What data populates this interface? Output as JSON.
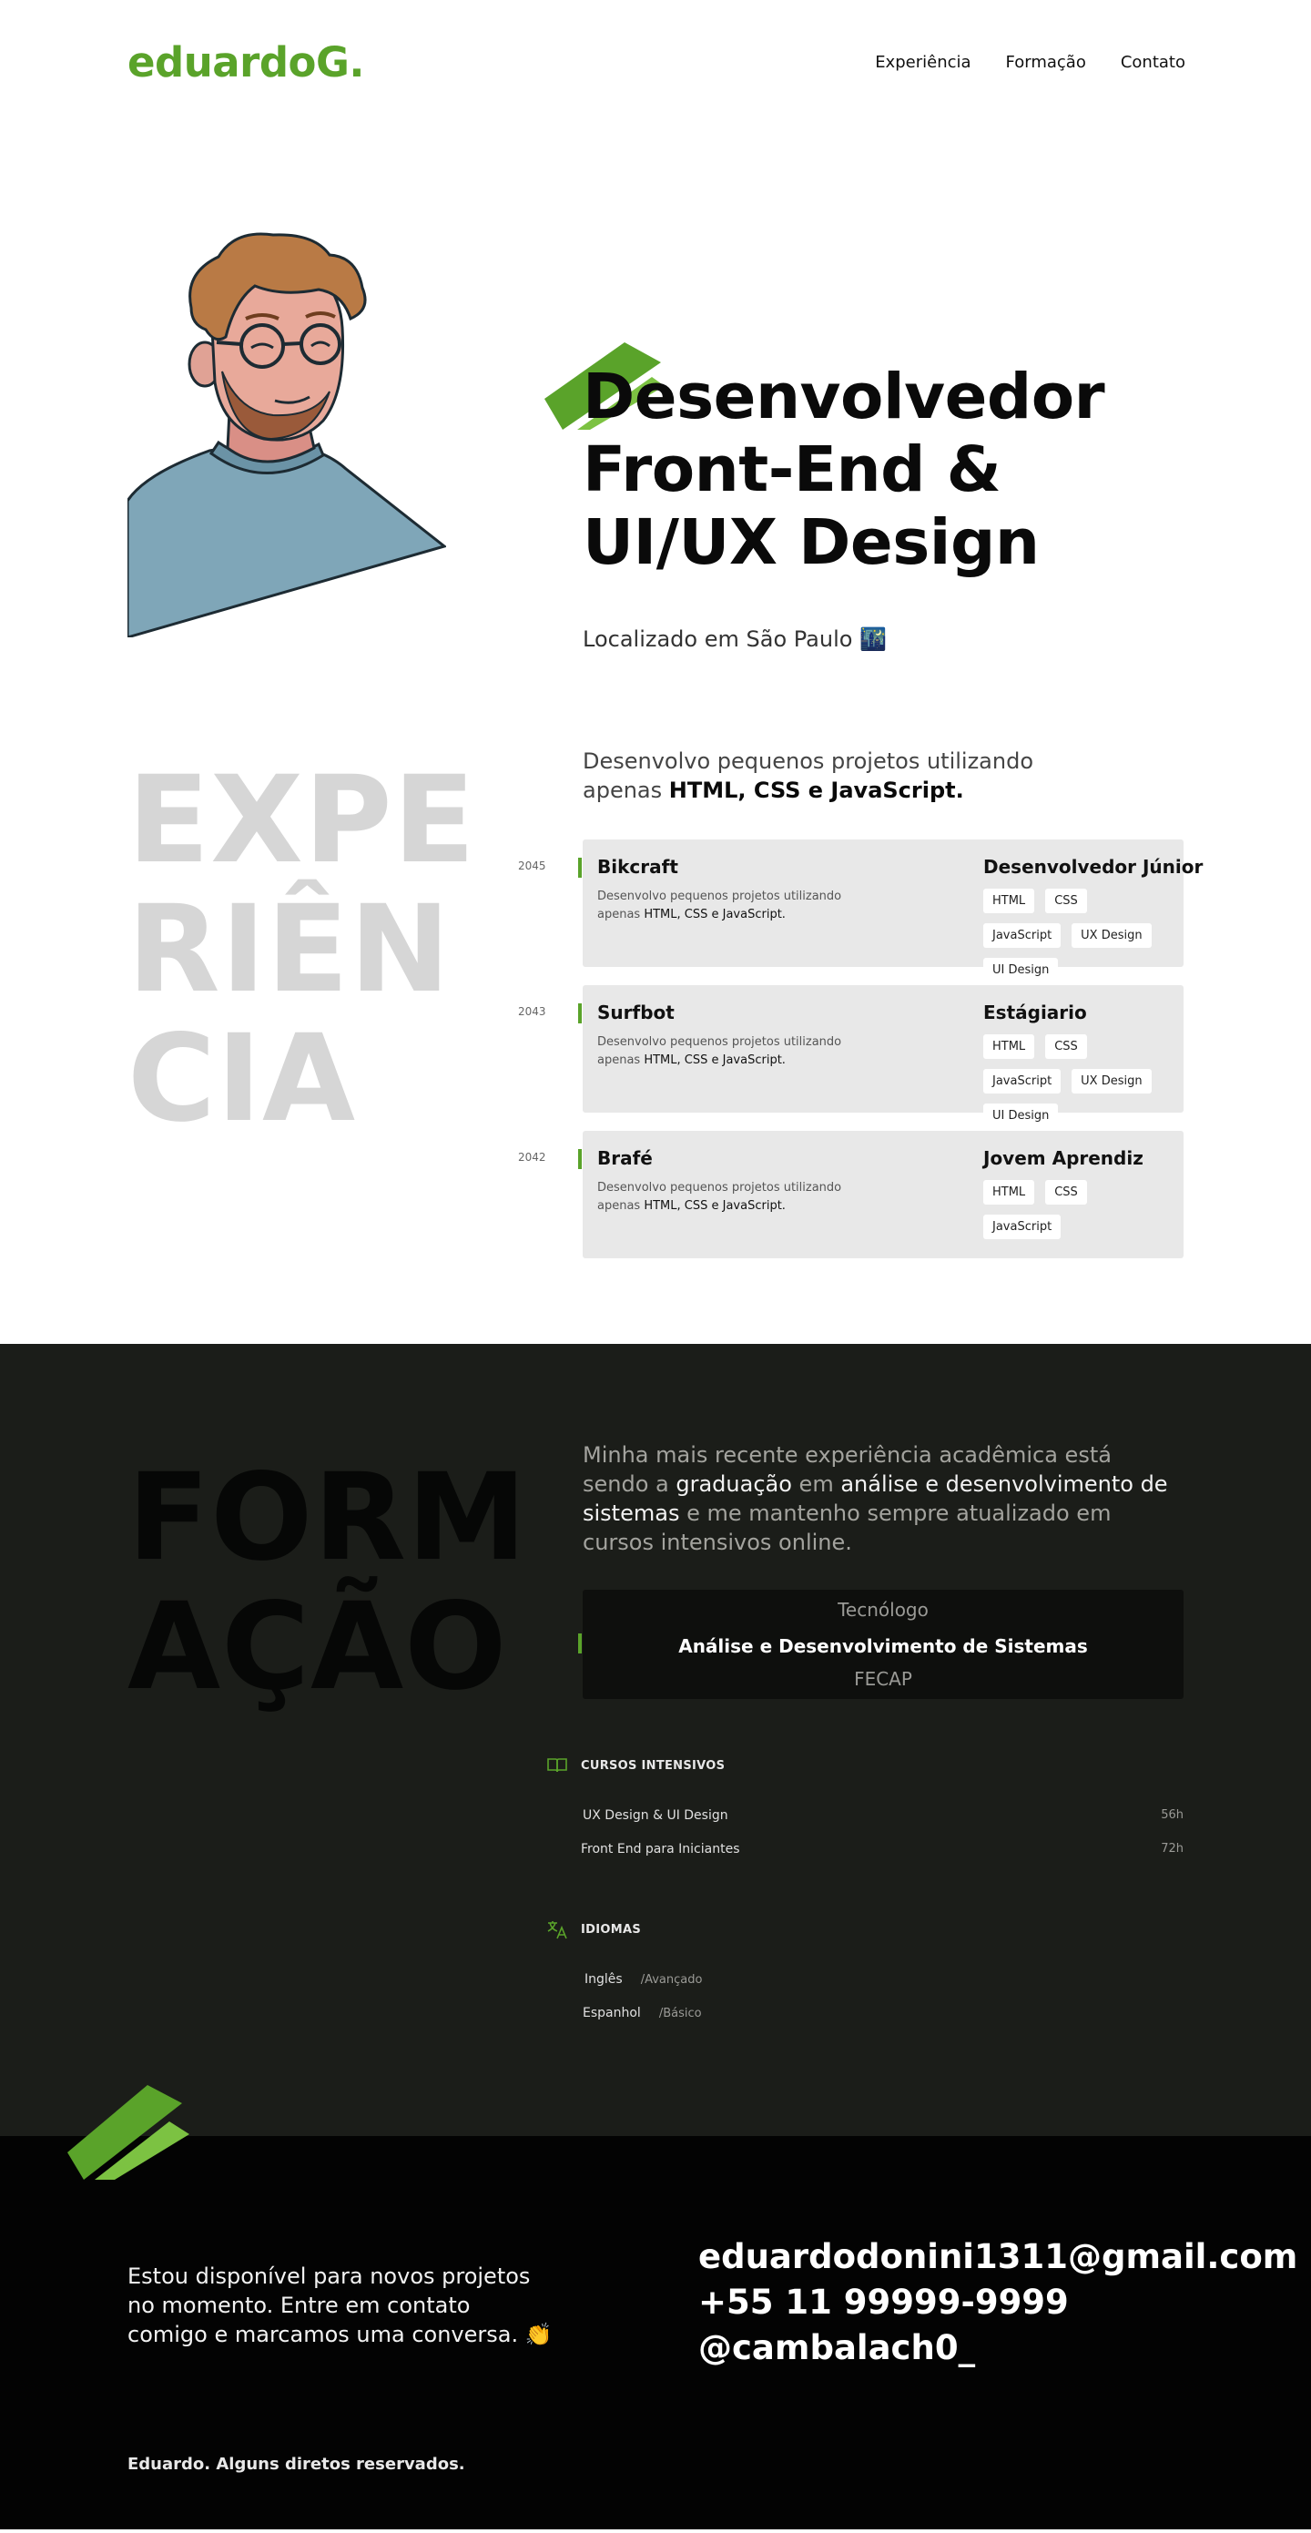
{
  "header": {
    "logo": "eduardoG.",
    "nav": [
      "Experiência",
      "Formação",
      "Contato"
    ]
  },
  "hero": {
    "title_lines": [
      "Desenvolvedor",
      "Front-End &",
      "UI/UX Design"
    ],
    "location": "Localizado em São Paulo 🌃"
  },
  "experience": {
    "big_lines": [
      "EXPE",
      "RIÊN",
      "CIA"
    ],
    "intro_prefix": "Desenvolvo pequenos projetos utilizando apenas",
    "intro_bold": "HTML, CSS e JavaScript.",
    "jobs": [
      {
        "year": "2045",
        "company": "Bikcraft",
        "desc_prefix": "Desenvolvo pequenos projetos utilizando apenas",
        "desc_bold": "HTML, CSS e JavaScript.",
        "role": "Desenvolvedor Júnior",
        "tags": [
          "HTML",
          "CSS",
          "JavaScript",
          "UX Design",
          "UI Design"
        ]
      },
      {
        "year": "2043",
        "company": "Surfbot",
        "desc_prefix": "Desenvolvo pequenos projetos utilizando apenas",
        "desc_bold": "HTML, CSS e JavaScript.",
        "role": "Estágiario",
        "tags": [
          "HTML",
          "CSS",
          "JavaScript",
          "UX Design",
          "UI Design"
        ]
      },
      {
        "year": "2042",
        "company": "Brafé",
        "desc_prefix": "Desenvolvo pequenos projetos utilizando apenas",
        "desc_bold": "HTML, CSS e JavaScript.",
        "role": "Jovem Aprendiz",
        "tags": [
          "HTML",
          "CSS",
          "JavaScript"
        ]
      }
    ]
  },
  "education": {
    "big_lines": [
      "FORM",
      "AÇÃO"
    ],
    "intro_parts": [
      {
        "text": "Minha mais recente experiência acadêmica está sendo a ",
        "hl": false
      },
      {
        "text": "graduação",
        "hl": true
      },
      {
        "text": " em ",
        "hl": false
      },
      {
        "text": "análise e desenvolvimento de sistemas",
        "hl": true
      },
      {
        "text": " e me mantenho sempre atualizado em cursos intensivos online.",
        "hl": false
      }
    ],
    "degree": {
      "type": "Tecnólogo",
      "name": "Análise e Desenvolvimento de Sistemas",
      "school": "FECAP"
    },
    "courses_heading": "CURSOS INTENSIVOS",
    "courses": [
      {
        "name": "UX Design & UI Design",
        "hours": "56h"
      },
      {
        "name": "Front End para Iniciantes",
        "hours": "72h"
      }
    ],
    "languages_heading": "IDIOMAS",
    "languages": [
      {
        "name": "Inglês",
        "level": "/Avançado"
      },
      {
        "name": "Espanhol",
        "level": "/Básico"
      }
    ]
  },
  "contact": {
    "message": "Estou disponível para novos projetos no momento. Entre em contato comigo e marcamos uma conversa. 👏",
    "email": "eduardodonini1311@gmail.com",
    "phone": "+55 11 99999-9999",
    "handle": "@cambalach0_",
    "copyright": "Eduardo. Alguns diretos reservados."
  },
  "colors": {
    "accent": "#5aa32a",
    "accent_light": "#7cc242",
    "dark_section": "#1b1d19",
    "footer": "#030303",
    "card": "#e8e8e8"
  }
}
